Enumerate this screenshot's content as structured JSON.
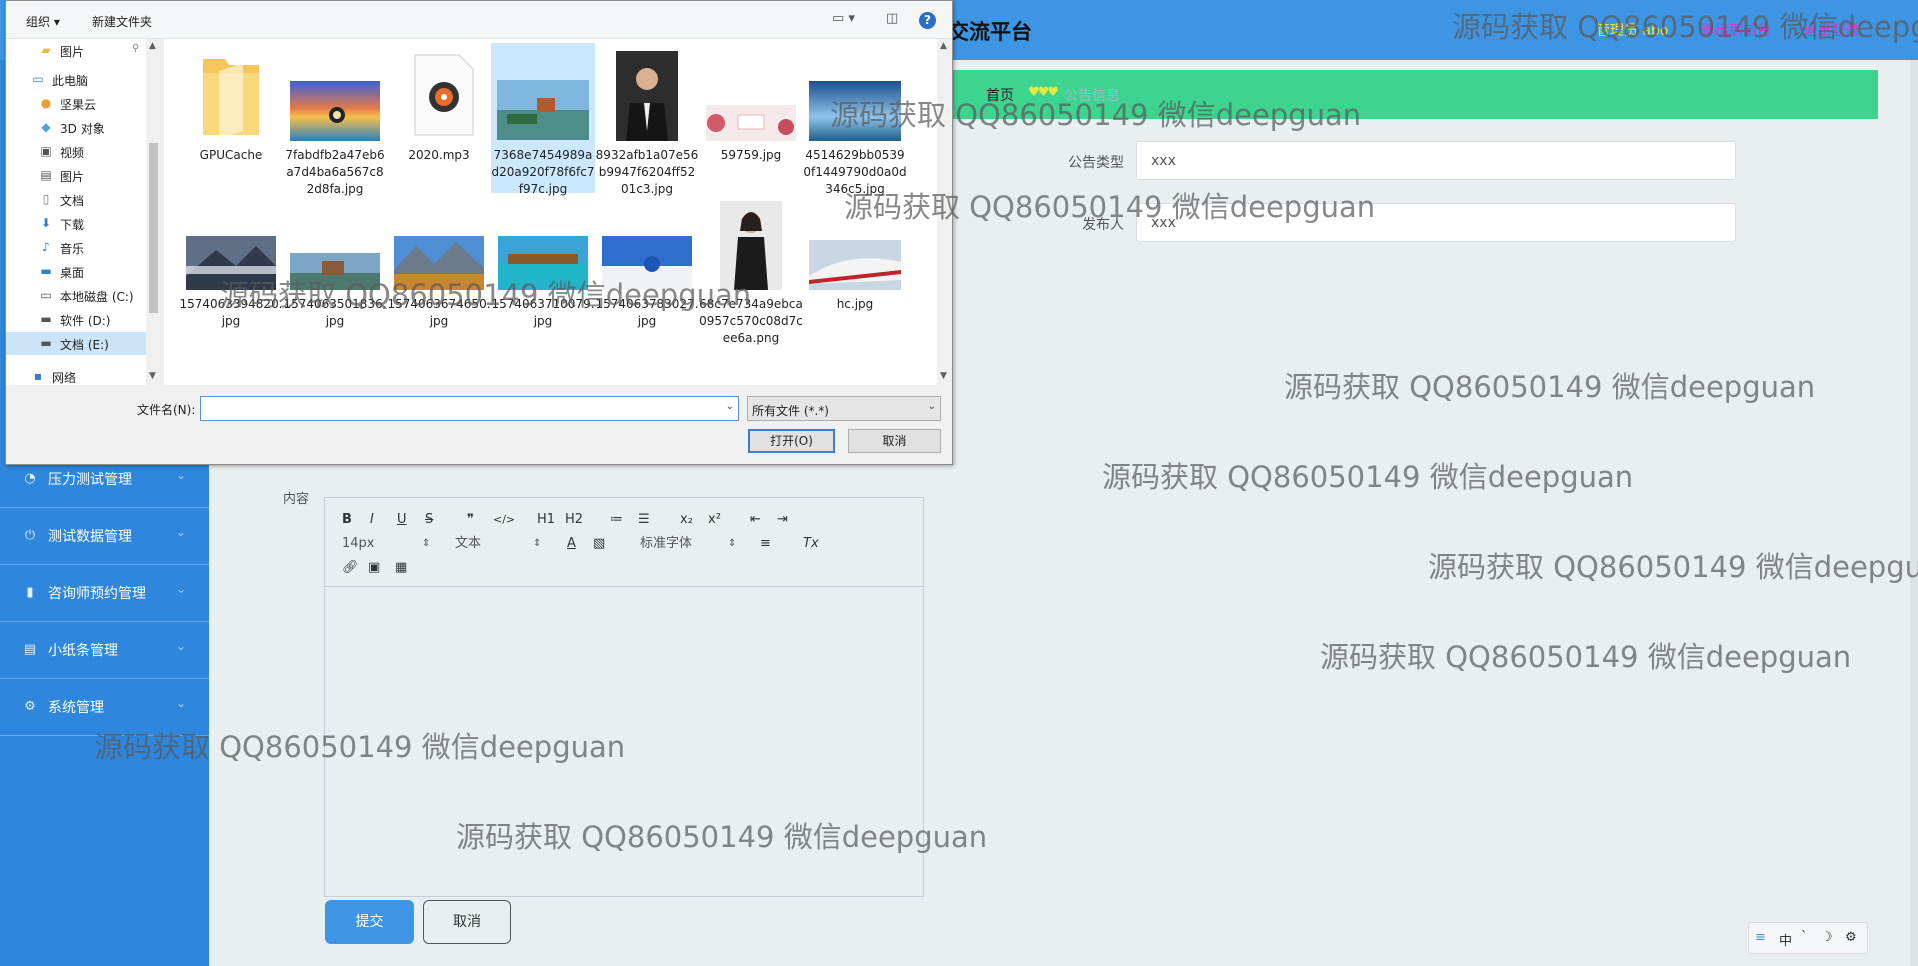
{
  "app": {
    "title": "心理咨询交流平台",
    "title_visible": "交流平台",
    "user_link": "管理员 abo",
    "back_link": "退出到前台",
    "logout_link": "退出登录"
  },
  "breadcrumb": {
    "home": "首页",
    "deco": "♥♥♥",
    "current": "公告信息"
  },
  "sidebar": {
    "items": [
      {
        "label": "压力测试管理",
        "icon": "gauge-icon"
      },
      {
        "label": "测试数据管理",
        "icon": "power-icon"
      },
      {
        "label": "咨询师预约管理",
        "icon": "bar-chart-icon"
      },
      {
        "label": "小纸条管理",
        "icon": "note-icon"
      },
      {
        "label": "系统管理",
        "icon": "settings-icon"
      }
    ]
  },
  "form": {
    "type_label": "公告类型",
    "type_value": "xxx",
    "publisher_label": "发布人",
    "publisher_value": "xxx",
    "content_label": "内容",
    "submit": "提交",
    "cancel": "取消"
  },
  "editor": {
    "row1": [
      "B",
      "I",
      "U",
      "S",
      "❞",
      "</>",
      "H1",
      "H2",
      "≔",
      "☰",
      "x₂",
      "x²",
      "⇤",
      "⇥"
    ],
    "font_size": "14px",
    "block_type": "文本",
    "font_family": "标准字体",
    "color_icon": "A",
    "clear_icon": "Tx"
  },
  "ime": {
    "lang": "中",
    "items": [
      "ˋ",
      "☽",
      "⚙"
    ]
  },
  "dialog": {
    "toolbar": {
      "organize": "组织 ▾",
      "new_folder": "新建文件夹",
      "help": "?"
    },
    "nav": [
      {
        "label": "图片",
        "icon": "picture-folder-icon",
        "indent": 1
      },
      {
        "label": "此电脑",
        "icon": "computer-icon",
        "indent": 0
      },
      {
        "label": "坚果云",
        "icon": "cloud-icon",
        "indent": 1
      },
      {
        "label": "3D 对象",
        "icon": "cube-icon",
        "indent": 1
      },
      {
        "label": "视频",
        "icon": "video-icon",
        "indent": 1
      },
      {
        "label": "图片",
        "icon": "picture-icon",
        "indent": 1
      },
      {
        "label": "文档",
        "icon": "document-icon",
        "indent": 1
      },
      {
        "label": "下载",
        "icon": "download-icon",
        "indent": 1
      },
      {
        "label": "音乐",
        "icon": "music-icon",
        "indent": 1
      },
      {
        "label": "桌面",
        "icon": "desktop-icon",
        "indent": 1
      },
      {
        "label": "本地磁盘 (C:)",
        "icon": "disk-c-icon",
        "indent": 1
      },
      {
        "label": "软件 (D:)",
        "icon": "disk-d-icon",
        "indent": 1
      },
      {
        "label": "文档 (E:)",
        "icon": "disk-e-icon",
        "indent": 1,
        "selected": true
      },
      {
        "label": "网络",
        "icon": "network-icon",
        "indent": 0
      }
    ],
    "files": [
      {
        "name": "GPUCache",
        "kind": "folder"
      },
      {
        "name": "7fabdfb2a47eb6a7d4ba6a567c82d8fa.jpg",
        "kind": "sunset"
      },
      {
        "name": "2020.mp3",
        "kind": "audio"
      },
      {
        "name": "7368e7454989ad20a920f78f6fc7f97c.jpg",
        "kind": "lake",
        "selected": true
      },
      {
        "name": "8932afb1a07e56b9947f6204ff5201c3.jpg",
        "kind": "portrait-man"
      },
      {
        "name": "59759.jpg",
        "kind": "banner"
      },
      {
        "name": "4514629bb05390f1449790d0a0d346c5.jpg",
        "kind": "sky"
      },
      {
        "name": "1574063394820.jpg",
        "kind": "mountain-fog"
      },
      {
        "name": "1574063501836.jpg",
        "kind": "lakehouse"
      },
      {
        "name": "1574063674650.jpg",
        "kind": "alps"
      },
      {
        "name": "1574063710079.jpg",
        "kind": "resort"
      },
      {
        "name": "1574063783027.jpg",
        "kind": "santorini"
      },
      {
        "name": "68c7e734a9ebca0957c570c08d7cee6a.png",
        "kind": "portrait-woman"
      },
      {
        "name": "hc.jpg",
        "kind": "train"
      }
    ],
    "filename_label": "文件名(N):",
    "filename_value": "",
    "filetype": "所有文件 (*.*)",
    "open": "打开(O)",
    "cancel": "取消"
  },
  "watermark": "源码获取 QQ86050149 微信deepguan",
  "colors": {
    "topbar": "#3d95e3",
    "sidebar": "#2e87dc",
    "breadcrumb": "#3dd48f",
    "content_bg": "#e9eef1",
    "submit": "#3d95e3"
  }
}
